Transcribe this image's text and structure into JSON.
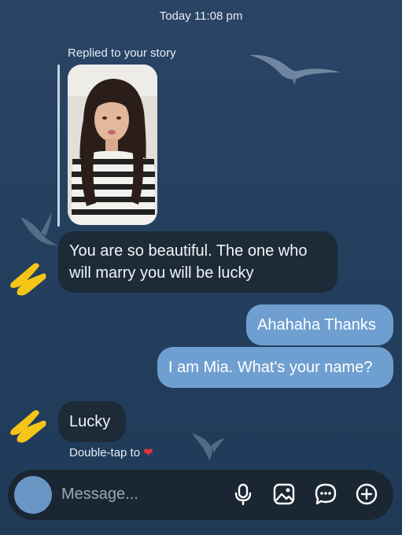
{
  "header": {
    "timestamp": "Today 11:08 pm"
  },
  "story_reply": {
    "caption": "Replied to your story"
  },
  "messages": [
    {
      "side": "received",
      "line1": "You are so beautiful. The one who",
      "line2": "will marry you will be lucky"
    },
    {
      "side": "sent",
      "text": "Ahahaha Thanks"
    },
    {
      "side": "sent",
      "text": "I am Mia. What's your name?"
    },
    {
      "side": "received",
      "text": "Lucky"
    }
  ],
  "hint": {
    "text": "Double-tap to",
    "heart": "❤"
  },
  "composer": {
    "placeholder": "Message..."
  },
  "colors": {
    "received_bubble": "#1d2a38",
    "sent_bubble": "#6f9fd0",
    "background": "#24405f",
    "heart": "#e8323a",
    "sticker": "#f5c518"
  },
  "icons": [
    "microphone-icon",
    "image-icon",
    "chat-bubble-icon",
    "add-circle-icon"
  ]
}
